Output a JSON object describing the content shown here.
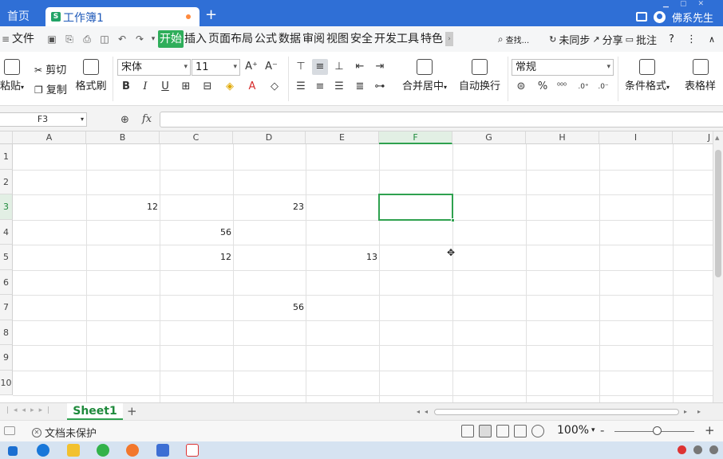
{
  "titlebar": {
    "home_tab": "首页",
    "doc_tab": "工作簿1",
    "doc_logo": "S",
    "new_tab": "+",
    "user_name": "佛系先生"
  },
  "menubar": {
    "file_label": "文件",
    "items": [
      "开始",
      "插入",
      "页面布局",
      "公式",
      "数据",
      "审阅",
      "视图",
      "安全",
      "开发工具",
      "特色"
    ],
    "search_label": "查找...",
    "sync_label": "未同步",
    "share_label": "分享",
    "comment_label": "批注",
    "help_label": "?"
  },
  "ribbon": {
    "paste_label": "粘贴",
    "cut_label": "剪切",
    "copy_label": "复制",
    "format_painter_label": "格式刷",
    "font_name": "宋体",
    "font_size": "11",
    "bold": "B",
    "italic": "I",
    "underline": "U",
    "merge_center_label": "合并居中",
    "wrap_text_label": "自动换行",
    "number_format": "常规",
    "percent": "%",
    "conditional_format_label": "条件格式",
    "table_style_label": "表格样"
  },
  "formulabar": {
    "cell_ref": "F3",
    "fx_label": "fx",
    "formula_value": ""
  },
  "grid": {
    "columns": [
      "A",
      "B",
      "C",
      "D",
      "E",
      "F",
      "G",
      "H",
      "I",
      "J"
    ],
    "rows": [
      "1",
      "2",
      "3",
      "4",
      "5",
      "6",
      "7",
      "8",
      "9",
      "10"
    ],
    "selected_col": "F",
    "selected_row": "3",
    "cells": [
      {
        "ref": "B3",
        "value": "12"
      },
      {
        "ref": "D3",
        "value": "23"
      },
      {
        "ref": "C4",
        "value": "56"
      },
      {
        "ref": "C5",
        "value": "12"
      },
      {
        "ref": "E5",
        "value": "13"
      },
      {
        "ref": "D7",
        "value": "56"
      }
    ]
  },
  "sheetbar": {
    "sheet_name": "Sheet1",
    "add_label": "+"
  },
  "statusbar": {
    "protect_label": "文档未保护",
    "zoom_label": "100%",
    "zoom_minus": "-",
    "zoom_plus": "+"
  },
  "colors": {
    "titlebar_bg": "#2f6fd6",
    "accent_green": "#2fa14f",
    "active_menu": "#2fae5b"
  }
}
